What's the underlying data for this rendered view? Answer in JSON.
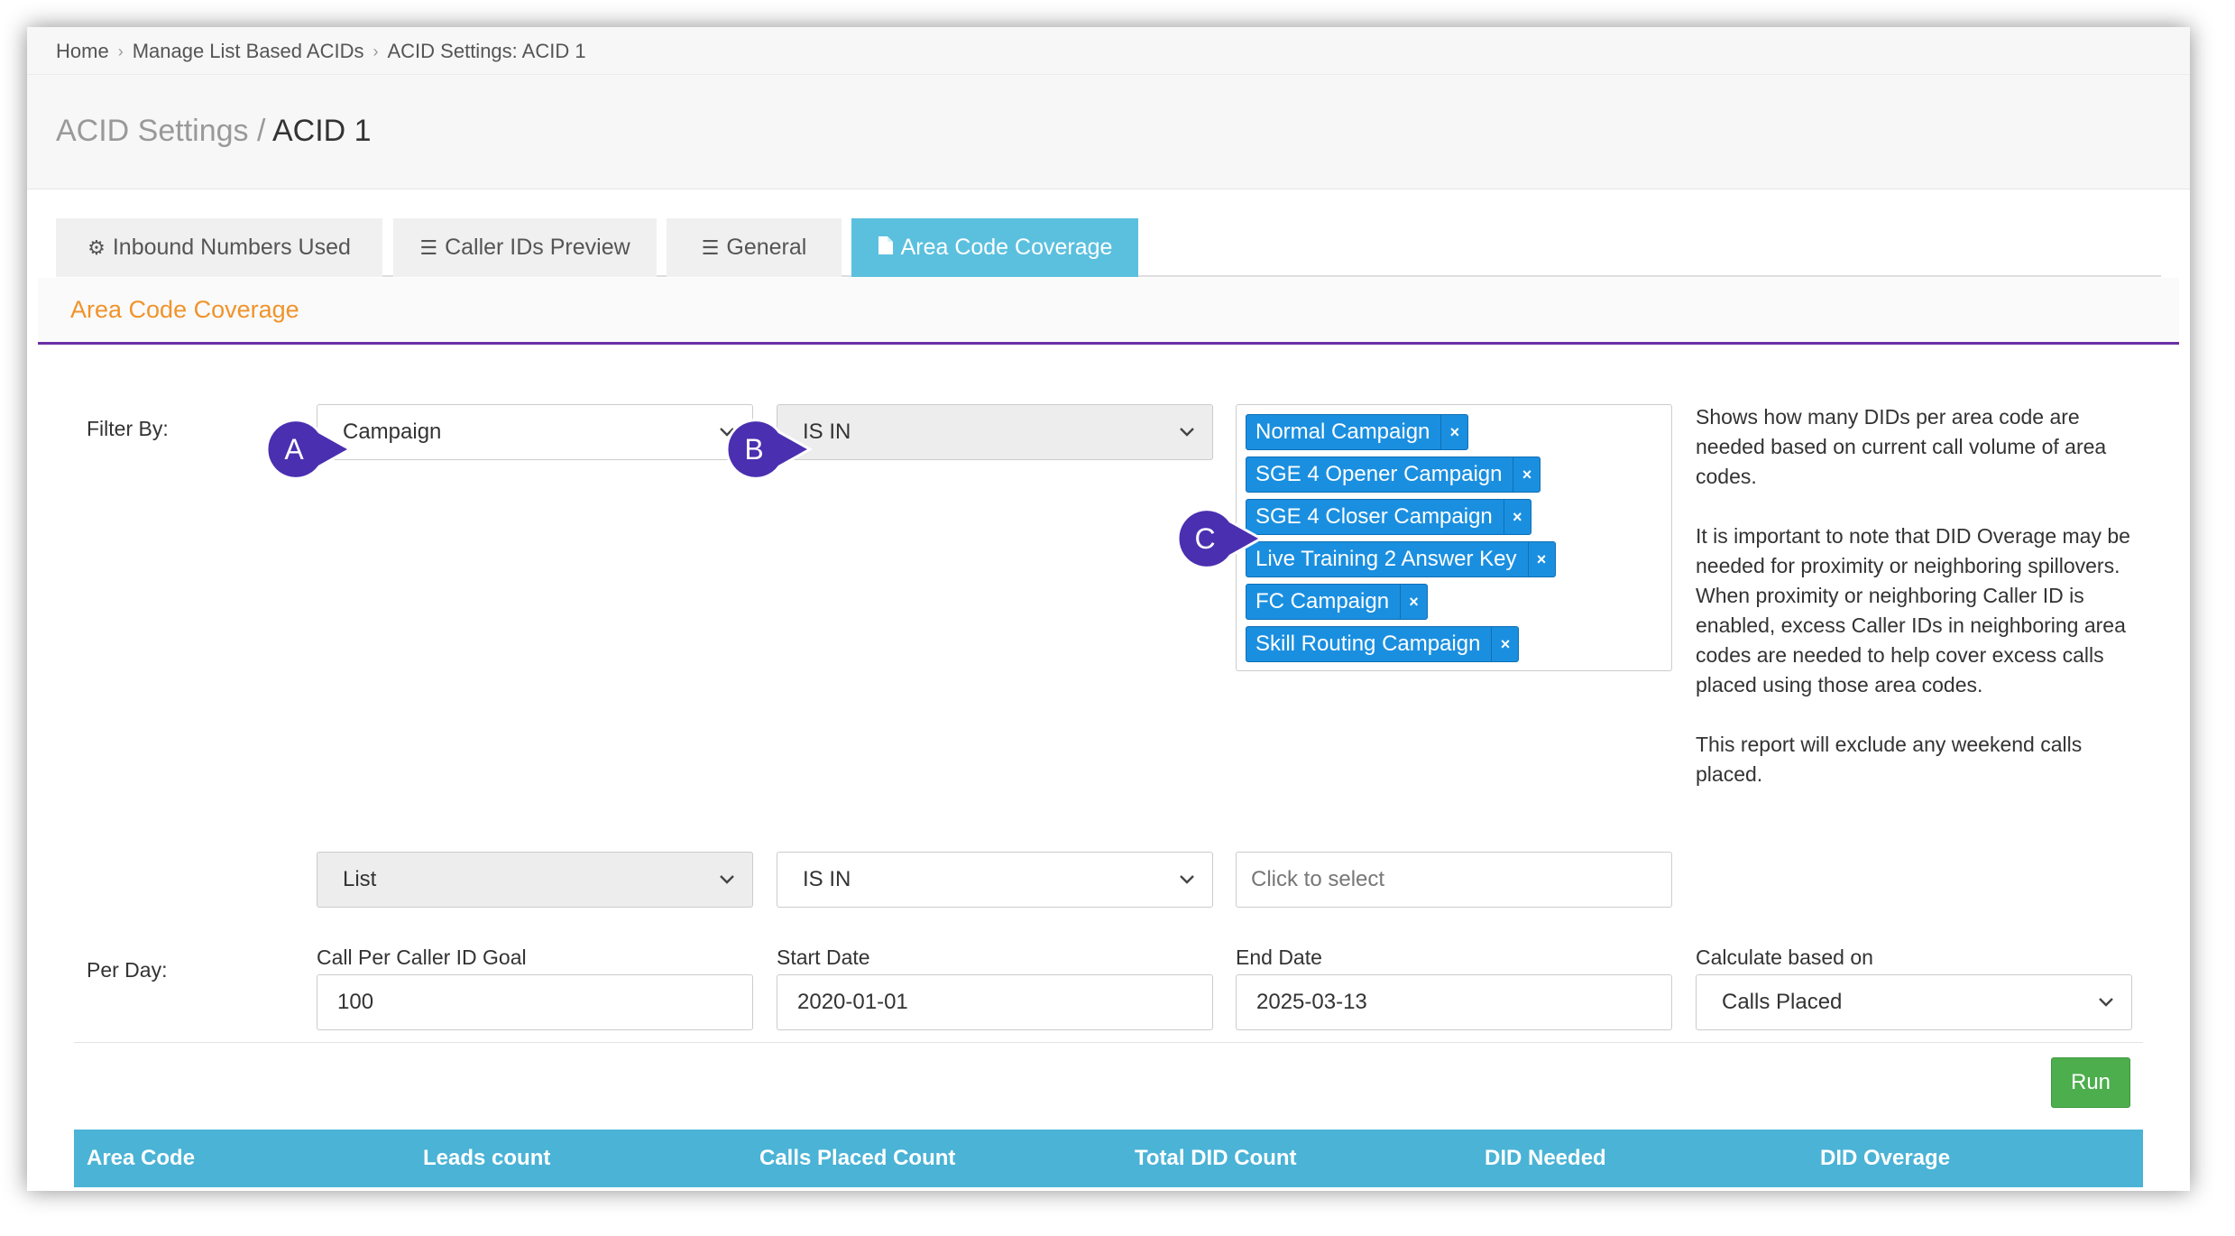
{
  "breadcrumb": [
    "Home",
    "Manage List Based ACIDs",
    "ACID Settings: ACID 1"
  ],
  "page_title": {
    "parent": "ACID Settings",
    "separator": " / ",
    "current": "ACID 1"
  },
  "tabs": [
    {
      "label": "Inbound Numbers Used",
      "icon": "gear-icon",
      "glyph": "⚙"
    },
    {
      "label": "Caller IDs Preview",
      "icon": "list-ol-icon",
      "glyph": "☰"
    },
    {
      "label": "General",
      "icon": "list-ol-icon",
      "glyph": "☰"
    },
    {
      "label": "Area Code Coverage",
      "icon": "file-icon",
      "glyph": "▐",
      "active": true
    }
  ],
  "section_title": "Area Code Coverage",
  "filter": {
    "label": "Filter By:",
    "row1": {
      "field": "Campaign",
      "operator": "IS IN",
      "values": [
        "Normal Campaign",
        "SGE 4 Opener Campaign",
        "SGE 4 Closer Campaign",
        "Live Training 2 Answer Key",
        "FC Campaign",
        "Skill Routing Campaign"
      ],
      "remove_glyph": "×"
    },
    "row2": {
      "field": "List",
      "operator": "IS IN",
      "placeholder": "Click to select"
    }
  },
  "help_text": [
    "Shows how many DIDs per area code are needed based on current call volume of area codes.",
    "It is important to note that DID Overage may be needed for proximity or neighboring spillovers. When proximity or neighboring Caller ID is enabled, excess Caller IDs in neighboring area codes are needed to help cover excess calls placed using those area codes.",
    "This report will exclude any weekend calls placed."
  ],
  "per_day": {
    "label": "Per Day:",
    "goal_label": "Call Per Caller ID Goal",
    "goal_value": "100",
    "start_label": "Start Date",
    "start_value": "2020-01-01",
    "end_label": "End Date",
    "end_value": "2025-03-13",
    "calc_label": "Calculate based on",
    "calc_value": "Calls Placed"
  },
  "run_label": "Run",
  "table_columns": [
    "Area Code",
    "Leads count",
    "Calls Placed Count",
    "Total DID Count",
    "DID Needed",
    "DID Overage"
  ],
  "callouts": [
    "A",
    "B",
    "C"
  ],
  "colors": {
    "accent": "#5bc0de",
    "tag": "#1a8fe0",
    "section_title": "#f0932b",
    "divider": "#6a2fa5",
    "run": "#4cae4c",
    "callout": "#4a2fb0"
  }
}
